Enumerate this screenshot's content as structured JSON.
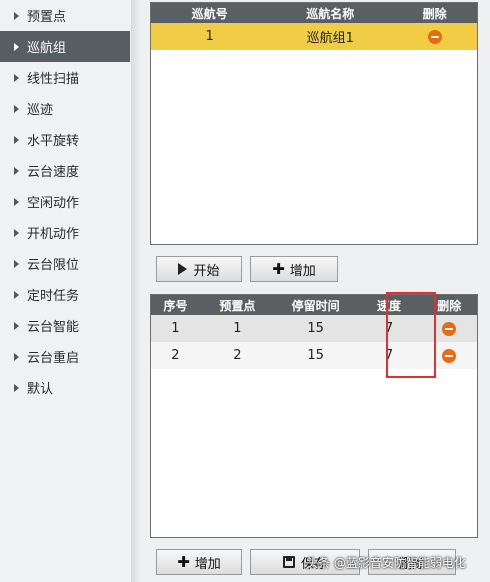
{
  "sidebar": {
    "items": [
      {
        "label": "预置点",
        "active": false
      },
      {
        "label": "巡航组",
        "active": true
      },
      {
        "label": "线性扫描",
        "active": false
      },
      {
        "label": "巡迹",
        "active": false
      },
      {
        "label": "水平旋转",
        "active": false
      },
      {
        "label": "云台速度",
        "active": false
      },
      {
        "label": "空闲动作",
        "active": false
      },
      {
        "label": "开机动作",
        "active": false
      },
      {
        "label": "云台限位",
        "active": false
      },
      {
        "label": "定时任务",
        "active": false
      },
      {
        "label": "云台智能",
        "active": false
      },
      {
        "label": "云台重启",
        "active": false
      },
      {
        "label": "默认",
        "active": false
      }
    ]
  },
  "tour_table": {
    "headers": [
      "巡航号",
      "巡航名称",
      "删除"
    ],
    "rows": [
      {
        "id": "1",
        "name": "巡航组1"
      }
    ]
  },
  "tour_buttons": {
    "start_label": "开始",
    "add_label": "增加"
  },
  "preset_table": {
    "headers": [
      "序号",
      "预置点",
      "停留时间",
      "速度",
      "删除"
    ],
    "rows": [
      {
        "index": "1",
        "preset": "1",
        "dwell": "15",
        "speed": "7"
      },
      {
        "index": "2",
        "preset": "2",
        "dwell": "15",
        "speed": "7"
      }
    ]
  },
  "preset_buttons": {
    "add_label": "增加",
    "save_label": "保存",
    "delete_label": "删除"
  },
  "watermark": "头条 @蓝影音安防智能弱电化",
  "colors": {
    "header_bg": "#5a5f64",
    "selected_row": "#f0cd44",
    "delete_icon": "#ec6a0f",
    "highlight": "#e13030"
  }
}
